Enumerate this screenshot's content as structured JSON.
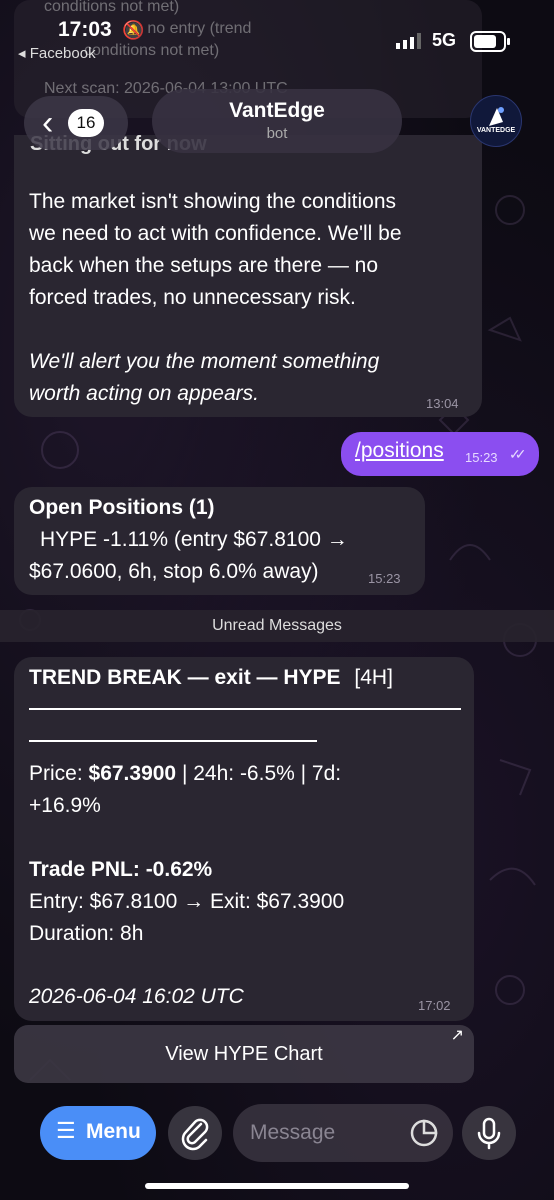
{
  "status_bar": {
    "time": "17:03",
    "back_app": "◂ Facebook",
    "network": "5G"
  },
  "ghost_message": {
    "line1": "conditions not met)",
    "line2": "– no entry (trend",
    "line3": "conditions not met)",
    "line4": "Next scan: 2026-06-04 13:00 UTC",
    "time": "13:04"
  },
  "header": {
    "back_count": "16",
    "bot_name": "VantEdge",
    "subtitle": "bot",
    "avatar_label": "VANTEDGE"
  },
  "messages": {
    "msg1": {
      "partial_header": "Sitting out for now",
      "lines": [
        "The market isn't showing the conditions",
        "we need to act with confidence. We'll be",
        "back when the setups are there — no",
        "forced trades, no unnecessary risk."
      ],
      "italic_lines": [
        "We'll alert you the moment something",
        "worth acting on appears."
      ],
      "time": "13:04"
    },
    "outgoing": {
      "text": "/positions",
      "time": "15:23"
    },
    "msg2": {
      "title": "Open Positions (1)",
      "line1": "HYPE   -1.11%  (entry $67.8100 →",
      "line2": "$67.0600, 6h, stop 6.0% away)",
      "time": "15:23"
    },
    "unread_label": "Unread Messages",
    "msg3": {
      "title": "TREND BREAK — exit — HYPE",
      "timeframe": "[4H]",
      "price_label": "Price: ",
      "price_value": "$67.3900",
      "price_rest": "  |  24h: -6.5%  |  7d:",
      "price_line2": "+16.9%",
      "pnl": "Trade PNL: -0.62%",
      "entry_exit": "Entry: $67.8100  →  Exit: $67.3900",
      "duration": "Duration: 8h",
      "timestamp": "2026-06-04 16:02 UTC",
      "time": "17:02"
    },
    "chart_button": "View HYPE Chart"
  },
  "input_bar": {
    "menu_label": "Menu",
    "placeholder": "Message"
  },
  "colors": {
    "accent": "#8b4ef0",
    "menu": "#4a8ef7",
    "bubble": "#2a2631"
  }
}
